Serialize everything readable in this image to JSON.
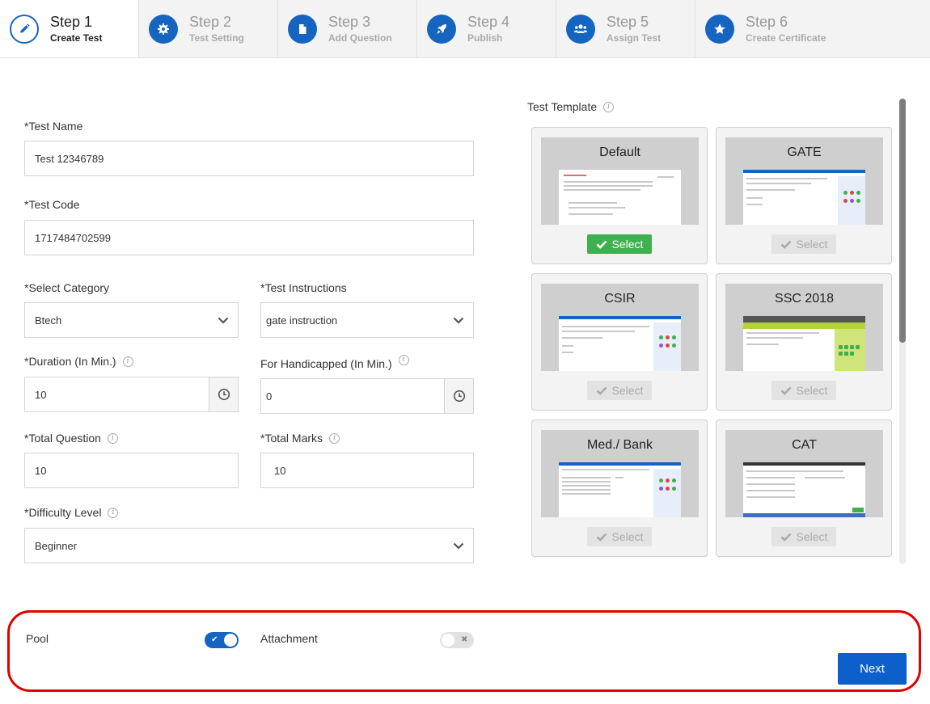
{
  "steps": [
    {
      "title": "Step 1",
      "subtitle": "Create Test",
      "icon": "pencil-icon"
    },
    {
      "title": "Step 2",
      "subtitle": "Test Setting",
      "icon": "gear-icon"
    },
    {
      "title": "Step 3",
      "subtitle": "Add Question",
      "icon": "document-icon"
    },
    {
      "title": "Step 4",
      "subtitle": "Publish",
      "icon": "rocket-icon"
    },
    {
      "title": "Step 5",
      "subtitle": "Assign Test",
      "icon": "users-icon"
    },
    {
      "title": "Step 6",
      "subtitle": "Create Certificate",
      "icon": "star-icon"
    }
  ],
  "form": {
    "test_name": {
      "label": "*Test Name",
      "value": "Test 12346789"
    },
    "test_code": {
      "label": "*Test Code",
      "value": "1717484702599"
    },
    "category": {
      "label": "*Select Category",
      "value": "Btech"
    },
    "instructions": {
      "label": "*Test Instructions",
      "value": "gate instruction"
    },
    "duration": {
      "label": "*Duration (In Min.)",
      "value": "10"
    },
    "handicapped": {
      "label": "For Handicapped (In Min.)",
      "value": "0"
    },
    "total_question": {
      "label": "*Total Question",
      "value": "10"
    },
    "total_marks": {
      "label": "*Total Marks",
      "value": "10"
    },
    "difficulty": {
      "label": "*Difficulty Level",
      "value": "Beginner"
    }
  },
  "templates": {
    "title": "Test Template",
    "select_label": "Select",
    "items": [
      {
        "name": "Default",
        "selected": true
      },
      {
        "name": "GATE",
        "selected": false
      },
      {
        "name": "CSIR",
        "selected": false
      },
      {
        "name": "SSC 2018",
        "selected": false
      },
      {
        "name": "Med./ Bank",
        "selected": false
      },
      {
        "name": "CAT",
        "selected": false
      }
    ]
  },
  "options": {
    "pool": {
      "label": "Pool",
      "enabled": true
    },
    "attachment": {
      "label": "Attachment",
      "enabled": false
    }
  },
  "next_label": "Next",
  "colors": {
    "primary": "#1565c0",
    "success": "#3fb04f",
    "highlight": "#e00000"
  }
}
